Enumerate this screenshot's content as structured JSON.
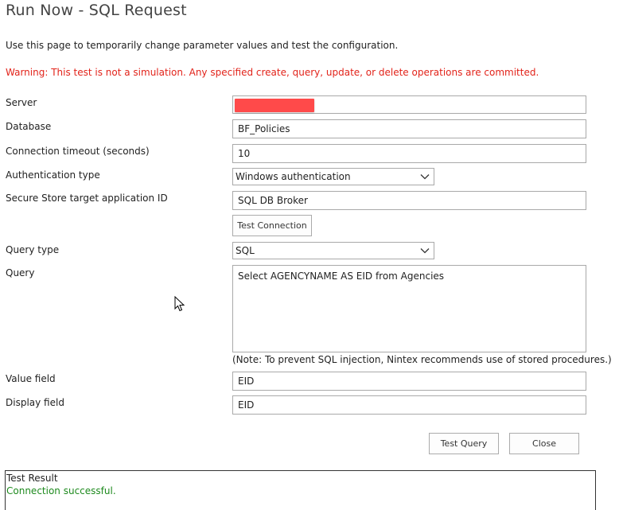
{
  "page": {
    "title": "Run Now - SQL Request",
    "intro": "Use this page to temporarily change parameter values and test the configuration.",
    "warning": "Warning: This test is not a simulation. Any specified create, query, update, or delete operations are committed."
  },
  "form": {
    "server": {
      "label": "Server",
      "value": ""
    },
    "database": {
      "label": "Database",
      "value": "BF_Policies"
    },
    "timeout": {
      "label": "Connection timeout (seconds)",
      "value": "10"
    },
    "auth_type": {
      "label": "Authentication type",
      "value": "Windows authentication"
    },
    "secure_store": {
      "label": "Secure Store target application ID",
      "value": "SQL DB Broker"
    },
    "test_connection_label": "Test Connection",
    "query_type": {
      "label": "Query type",
      "value": "SQL"
    },
    "query": {
      "label": "Query",
      "value": "Select AGENCYNAME AS EID from Agencies"
    },
    "note": "(Note: To prevent SQL injection, Nintex recommends use of stored procedures.)",
    "value_field": {
      "label": "Value field",
      "value": "EID"
    },
    "display_field": {
      "label": "Display field",
      "value": "EID"
    }
  },
  "actions": {
    "test_query_label": "Test Query",
    "close_label": "Close"
  },
  "result": {
    "title": "Test Result",
    "message": "Connection successful."
  },
  "colors": {
    "warning": "#e2231a",
    "success": "#1e8a1e",
    "redaction": "#ff4a4a"
  },
  "icons": {
    "select_arrow": "chevron-down-icon",
    "cursor": "mouse-pointer-icon"
  }
}
